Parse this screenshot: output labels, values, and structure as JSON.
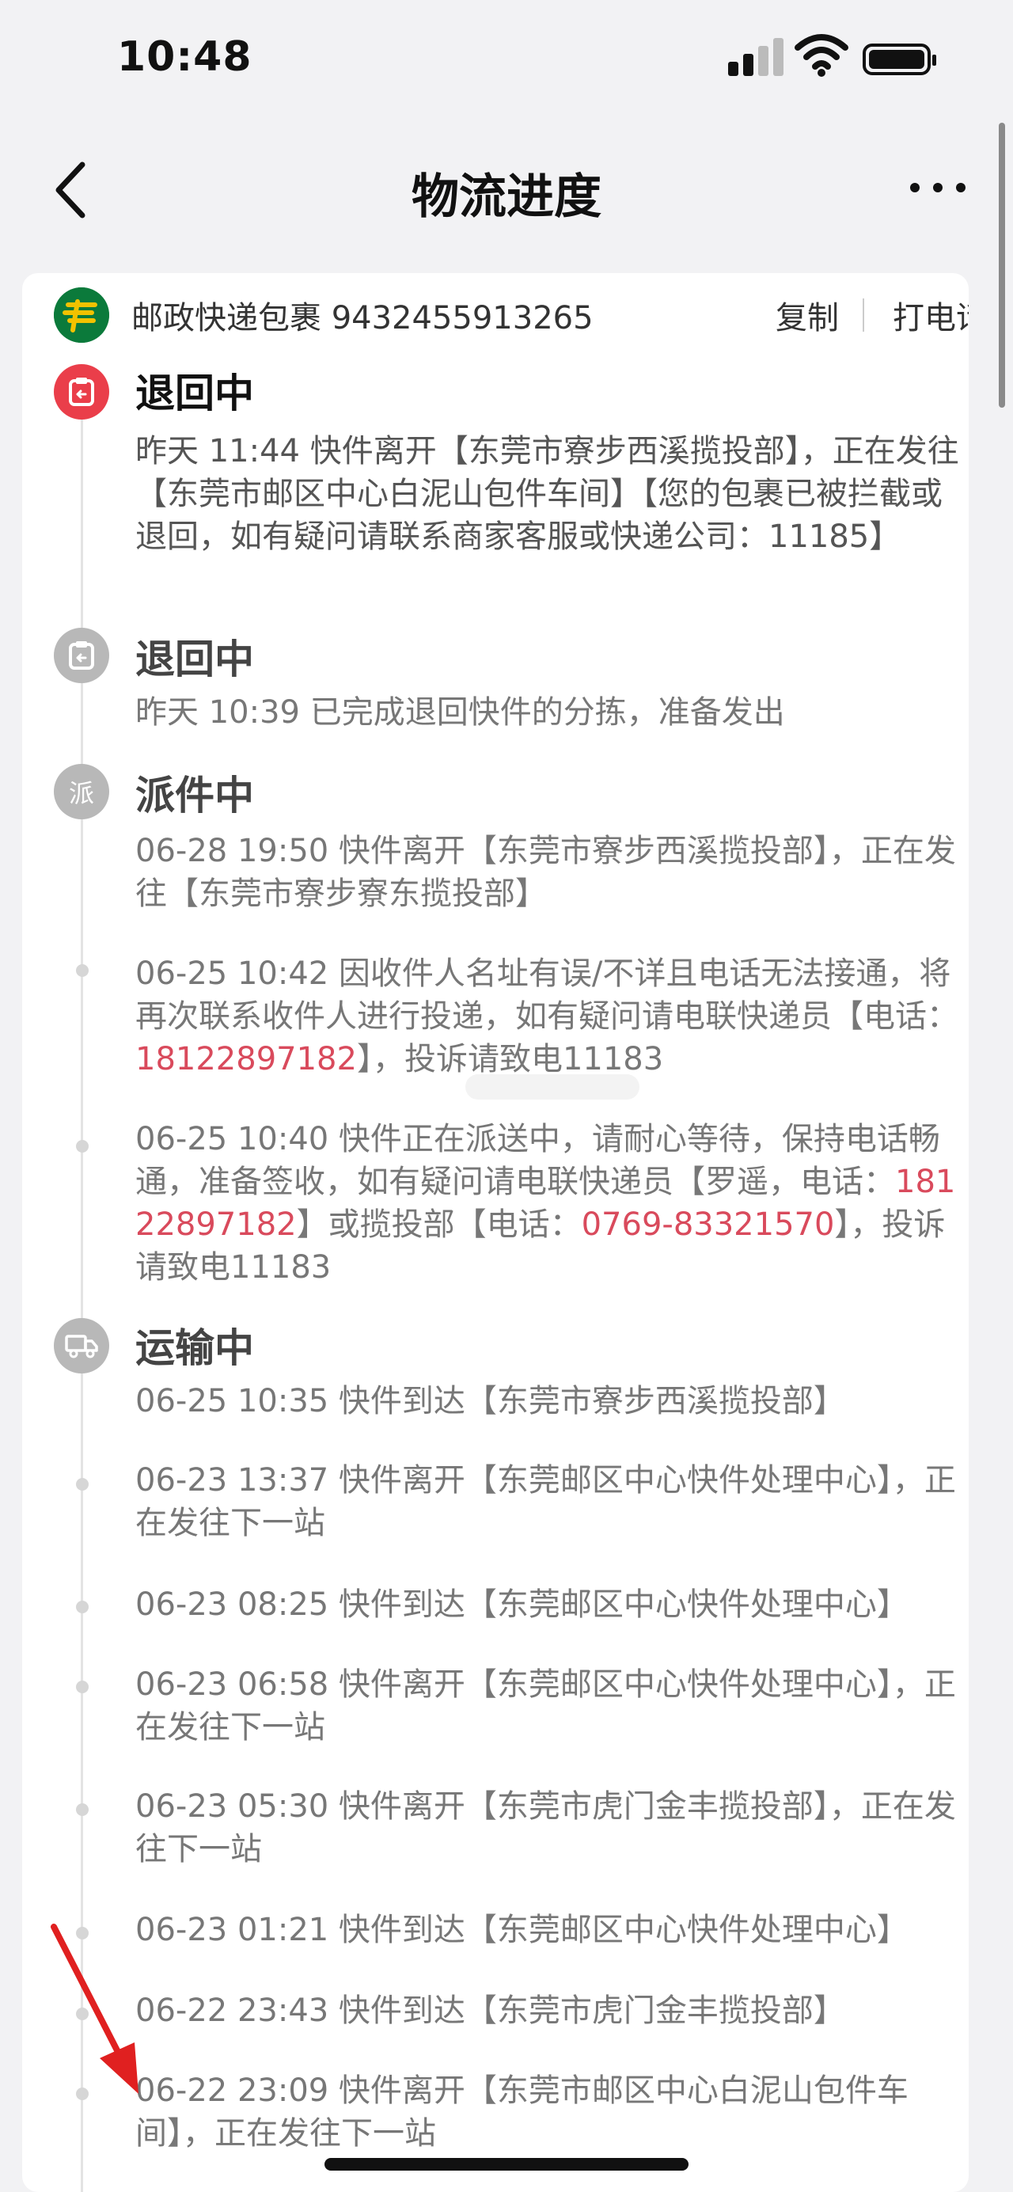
{
  "status_bar": {
    "time": "10:48"
  },
  "nav": {
    "title": "物流进度"
  },
  "carrier": {
    "text": "邮政快递包裹 9432455913265",
    "copy_label": "复制",
    "call_label": "打电话"
  },
  "statuses": {
    "s1": "退回中",
    "s2": "退回中",
    "s3": "派件中",
    "s4": "运输中"
  },
  "icons": {
    "s3_char": "派"
  },
  "events": {
    "e1": "昨天 11:44 快件离开【东莞市寮步西溪揽投部】，正在发往【东莞市邮区中心白泥山包件车间】【您的包裹已被拦截或退回，如有疑问请联系商家客服或快递公司：11185】",
    "e2": "昨天 10:39 已完成退回快件的分拣，准备发出",
    "e3": "06-28 19:50 快件离开【东莞市寮步西溪揽投部】，正在发往【东莞市寮步寮东揽投部】",
    "e4": {
      "pre": "06-25 10:42 因收件人名址有误/不详且电话无法接通，将再次联系收件人进行投递，如有疑问请电联快递员【电话：",
      "phone": "18122897182",
      "post": "】，投诉请致电11183"
    },
    "e5": {
      "pre": "06-25 10:40 快件正在派送中，请耐心等待，保持电话畅通，准备签收，如有疑问请电联快递员【罗遥，电话：",
      "phone1": "18122897182",
      "mid": "】或揽投部【电话：",
      "phone2": "0769-83321570",
      "post": "】，投诉请致电11183"
    },
    "e6": "06-25 10:35 快件到达【东莞市寮步西溪揽投部】",
    "e7": "06-23 13:37 快件离开【东莞邮区中心快件处理中心】，正在发往下一站",
    "e8": "06-23 08:25 快件到达【东莞邮区中心快件处理中心】",
    "e9": "06-23 06:58 快件离开【东莞邮区中心快件处理中心】，正在发往下一站",
    "e10": "06-23 05:30 快件离开【东莞市虎门金丰揽投部】，正在发往下一站",
    "e11": "06-23 01:21 快件到达【东莞邮区中心快件处理中心】",
    "e12": "06-22 23:43 快件到达【东莞市虎门金丰揽投部】",
    "e13": "06-22 23:09 快件离开【东莞市邮区中心白泥山包件车间】，正在发往下一站"
  },
  "colors": {
    "accent": "#ea3e4a",
    "phone": "#d94a5c",
    "carrier_green": "#0b7a3b"
  }
}
